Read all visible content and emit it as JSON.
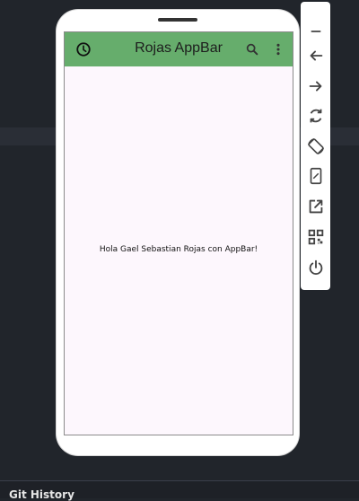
{
  "app": {
    "title": "Rojas AppBar",
    "body_text": "Hola Gael Sebastian Rojas con AppBar!",
    "appbar_color": "#66ad6c",
    "background_color": "#fdf7fd",
    "leading_icon": "clock-icon",
    "actions": [
      "search-icon",
      "more-vert-icon"
    ]
  },
  "emulator_toolbar": {
    "buttons": [
      "minimize-icon",
      "back-icon",
      "forward-icon",
      "rotate-icon",
      "rotate-screen-icon",
      "fold-icon",
      "open-external-icon",
      "qr-code-icon",
      "power-icon"
    ]
  },
  "ide": {
    "bottom_panel_title": "Git History"
  }
}
